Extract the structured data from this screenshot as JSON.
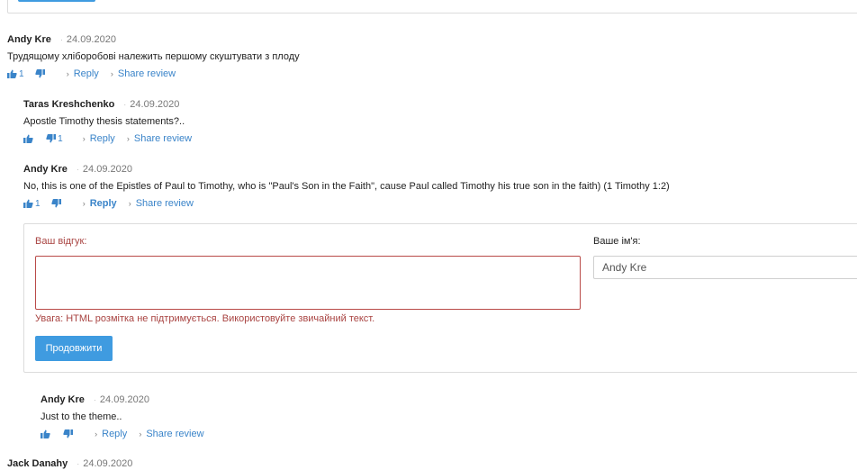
{
  "comments": [
    {
      "author": "Andy Kre",
      "date": "24.09.2020",
      "text": "Трудящому хліборобові належить першому скуштувати з плоду",
      "likes": "1",
      "dislikes": "",
      "reply": "Reply",
      "share": "Share review"
    },
    {
      "author": "Taras Kreshchenko",
      "date": "24.09.2020",
      "text": "Apostle Timothy thesis statements?..",
      "likes": "",
      "dislikes": "1",
      "reply": "Reply",
      "share": "Share review"
    },
    {
      "author": "Andy Kre",
      "date": "24.09.2020",
      "text": "No, this is one of the Epistles of Paul to Timothy, who is \"Paul's Son in the Faith\", cause Paul called Timothy his true son in the faith) (1 Timothy 1:2)",
      "likes": "1",
      "dislikes": "",
      "reply": "Reply",
      "share": "Share review"
    },
    {
      "author": "Andy Kre",
      "date": "24.09.2020",
      "text": "Just to the theme..",
      "likes": "",
      "dislikes": "",
      "reply": "Reply",
      "share": "Share review"
    },
    {
      "author": "Jack Danahy",
      "date": "24.09.2020"
    }
  ],
  "form": {
    "review_label": "Ваш відгук:",
    "name_label": "Ваше ім'я:",
    "name_value": "Andy Kre",
    "warning": "Увага: HTML розмітка не підтримується. Використовуйте звичайний текст.",
    "submit": "Продовжити"
  },
  "colors": {
    "link": "#3a84c9",
    "error": "#a94442",
    "button": "#3f9be0"
  },
  "icons": {
    "like": "thumbs-up-icon",
    "dislike": "thumbs-down-icon",
    "arrow": "chevron-right-icon"
  }
}
